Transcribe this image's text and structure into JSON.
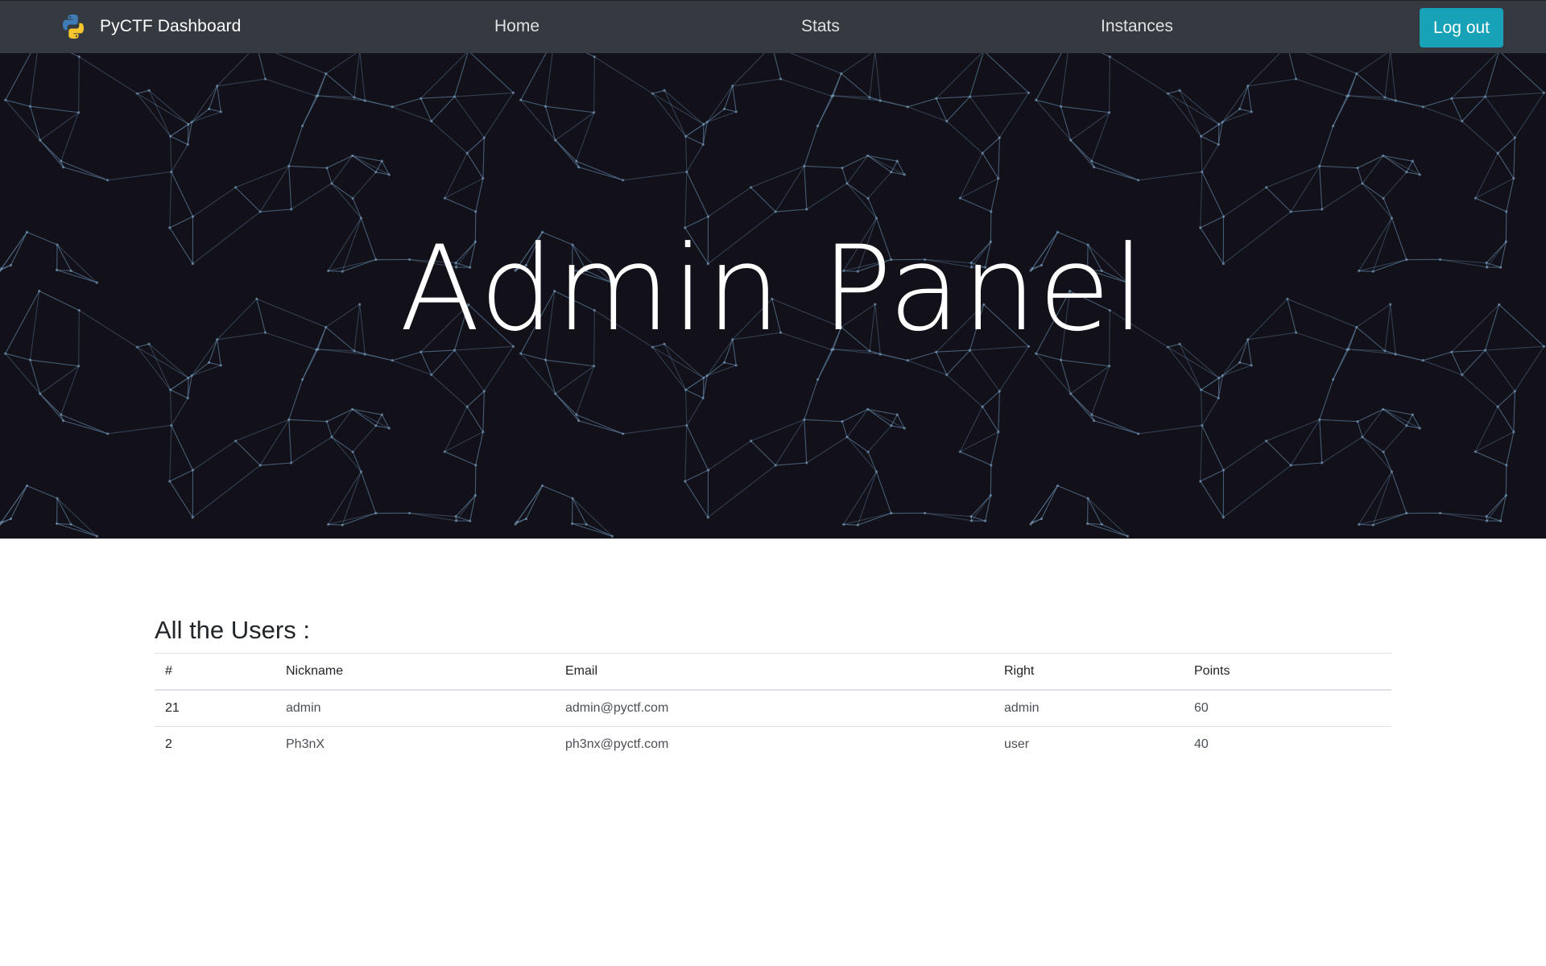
{
  "navbar": {
    "brand": "PyCTF Dashboard",
    "brand_icon": "python-logo-icon",
    "links": [
      {
        "label": "Home"
      },
      {
        "label": "Stats"
      },
      {
        "label": "Instances"
      }
    ],
    "logout_label": "Log out",
    "background": "#343a40",
    "logout_color": "#17a2b8"
  },
  "hero": {
    "title": "Admin Panel",
    "background": "#121018",
    "pattern": "polygon-network"
  },
  "users": {
    "heading": "All the Users :",
    "columns": [
      "#",
      "Nickname",
      "Email",
      "Right",
      "Points"
    ],
    "rows": [
      {
        "id": "21",
        "nickname": "admin",
        "email": "admin@pyctf.com",
        "right": "admin",
        "points": "60"
      },
      {
        "id": "2",
        "nickname": "Ph3nX",
        "email": "ph3nx@pyctf.com",
        "right": "user",
        "points": "40"
      }
    ]
  }
}
